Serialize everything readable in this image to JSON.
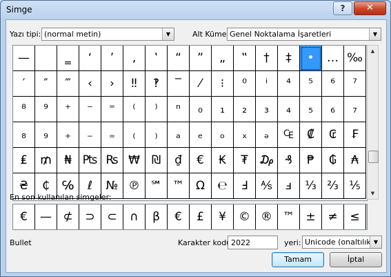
{
  "window": {
    "title": "Simge",
    "help": "?",
    "close": "✕"
  },
  "font": {
    "label": "Yazı tipi:",
    "value": "(normal metin)"
  },
  "subset": {
    "label": "Alt Küme:",
    "value": "Genel Noktalama İşaretleri"
  },
  "symbols": [
    "—",
    "",
    "‗",
    "‘",
    "’",
    "‚",
    "‛",
    "“",
    "”",
    "„",
    "‟",
    "†",
    "‡",
    "•",
    "…",
    "‰",
    "′",
    "″",
    "‴",
    "‹",
    "›",
    "‼",
    "‽",
    "‾",
    "⁄",
    "⁝",
    "⁰",
    "ⁱ",
    "⁴",
    "⁵",
    "⁶",
    "⁷",
    "⁸",
    "⁹",
    "⁺",
    "⁻",
    "⁼",
    "⁽",
    "⁾",
    "ⁿ",
    "₀",
    "₁",
    "₂",
    "₃",
    "₄",
    "₅",
    "₆",
    "₇",
    "₈",
    "₉",
    "₊",
    "₋",
    "₌",
    "₍",
    "₎",
    "ₐ",
    "ₑ",
    "ₒ",
    "ₓ",
    "ₔ",
    "₠",
    "₡",
    "₢",
    "₣",
    "₤",
    "₥",
    "₦",
    "₧",
    "₨",
    "₩",
    "₪",
    "₫",
    "€",
    "₭",
    "₮",
    "₯",
    "₰",
    "₱",
    "₲",
    "₳",
    "₴",
    "₵",
    "℅",
    "ℓ",
    "№",
    "℗",
    "℠",
    "™",
    "Ω",
    "℮",
    "Ⅎ",
    "⅍",
    "ⅎ",
    "⅓",
    "⅔",
    "⅕"
  ],
  "selected_index": 13,
  "recent": {
    "label": "En son kullanılan simgeler:",
    "items": [
      "€",
      "—",
      "⊄",
      "⊃",
      "⊂",
      "∩",
      "β",
      "€",
      "£",
      "¥",
      "©",
      "®",
      "™",
      "±",
      "≠",
      "≤",
      "≥"
    ]
  },
  "char_name": "Bullet",
  "code": {
    "label": "Karakter kodu:",
    "value": "2022",
    "from_label": "yeri:",
    "from_value": "Unicode (onaltılık)"
  },
  "buttons": {
    "ok": "Tamam",
    "cancel": "İptal"
  }
}
